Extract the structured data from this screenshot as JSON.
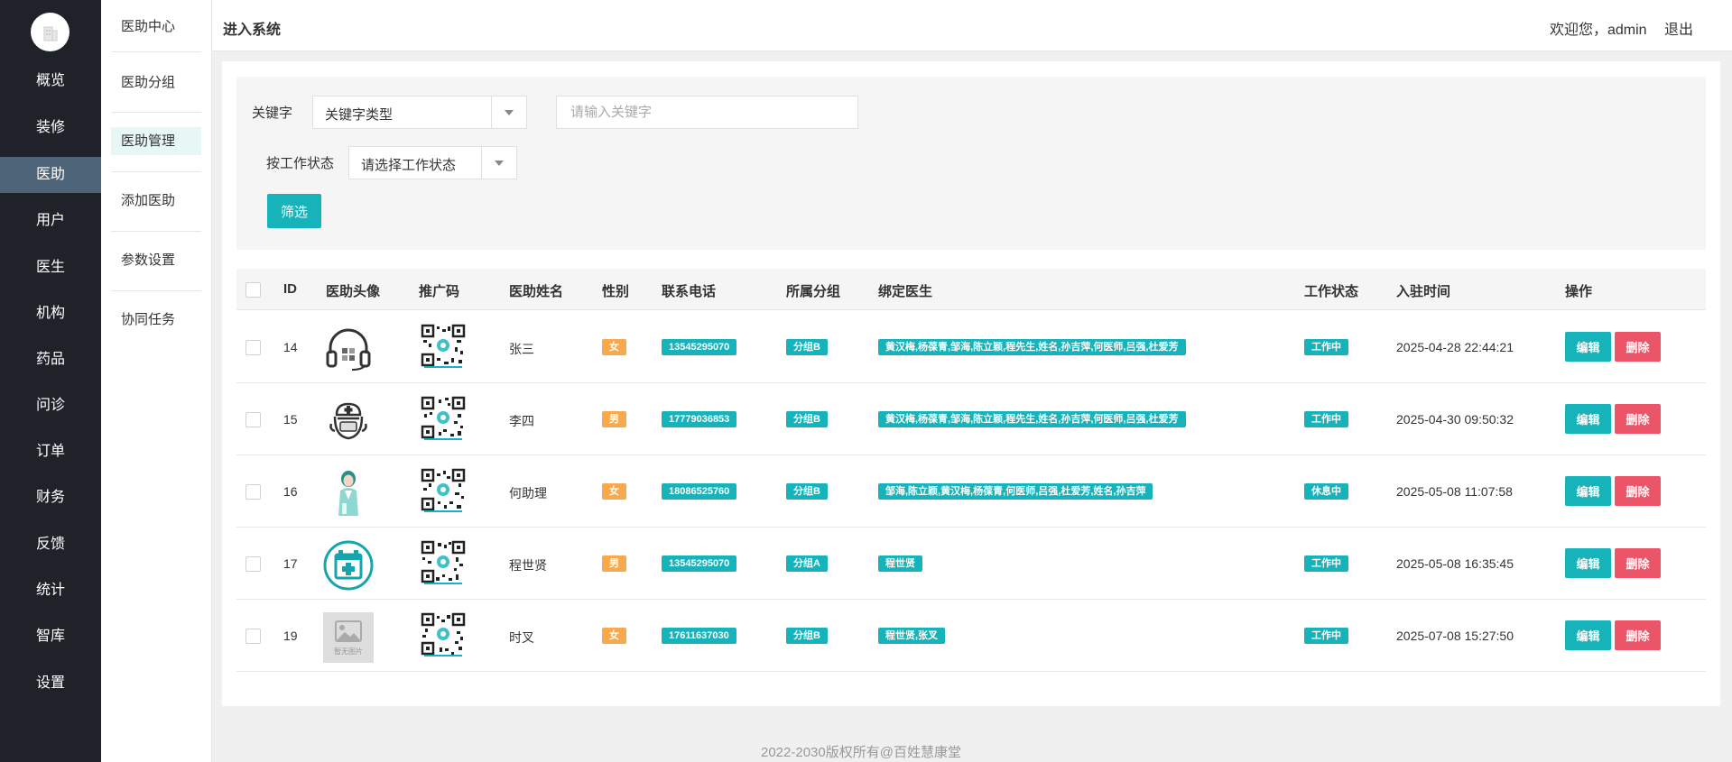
{
  "nav1": {
    "logo_icon": "building-icon",
    "items": [
      "概览",
      "装修",
      "医助",
      "用户",
      "医生",
      "机构",
      "药品",
      "问诊",
      "订单",
      "财务",
      "反馈",
      "统计",
      "智库",
      "设置"
    ],
    "active_index": 2
  },
  "nav2": {
    "items": [
      "医助中心",
      "医助分组",
      "医助管理",
      "添加医助",
      "参数设置",
      "协同任务"
    ],
    "active_index": 2
  },
  "header": {
    "title": "进入系统",
    "welcome": "欢迎您，admin",
    "logout": "退出"
  },
  "filter": {
    "keyword_label": "关键字",
    "keyword_type_value": "关键字类型",
    "keyword_placeholder": "请输入关键字",
    "status_label": "按工作状态",
    "status_value": "请选择工作状态",
    "submit_label": "筛选"
  },
  "table": {
    "headers": [
      "ID",
      "医助头像",
      "推广码",
      "医助姓名",
      "性别",
      "联系电话",
      "所属分组",
      "绑定医生",
      "工作状态",
      "入驻时间",
      "操作"
    ],
    "edit_label": "编辑",
    "delete_label": "删除",
    "rows": [
      {
        "id": "14",
        "avatar": "headset-avatar-icon",
        "name": "张三",
        "gender": "女",
        "phone": "13545295070",
        "group": "分组B",
        "doctors": "黄汉梅,杨葆青,邹海,陈立颖,程先生,姓名,孙吉萍,何医师,吕强,杜爱芳",
        "status": "工作中",
        "time": "2025-04-28 22:44:21"
      },
      {
        "id": "15",
        "avatar": "nurse-avatar-icon",
        "name": "李四",
        "gender": "男",
        "phone": "17779036853",
        "group": "分组B",
        "doctors": "黄汉梅,杨葆青,邹海,陈立颖,程先生,姓名,孙吉萍,何医师,吕强,杜爱芳",
        "status": "工作中",
        "time": "2025-04-30 09:50:32"
      },
      {
        "id": "16",
        "avatar": "female-doctor-avatar-icon",
        "name": "何助理",
        "gender": "女",
        "phone": "18086525760",
        "group": "分组B",
        "doctors": "邹海,陈立颖,黄汉梅,杨葆青,何医师,吕强,杜爱芳,姓名,孙吉萍",
        "status": "休息中",
        "time": "2025-05-08 11:07:58"
      },
      {
        "id": "17",
        "avatar": "hospital-avatar-icon",
        "name": "程世贤",
        "gender": "男",
        "phone": "13545295070",
        "group": "分组A",
        "doctors": "程世贤",
        "status": "工作中",
        "time": "2025-05-08 16:35:45"
      },
      {
        "id": "19",
        "avatar": "no-image-placeholder-icon",
        "avatar_text": "暂无图片",
        "name": "时叉",
        "gender": "女",
        "phone": "17611637030",
        "group": "分组B",
        "doctors": "程世贤,张叉",
        "status": "工作中",
        "time": "2025-07-08 15:27:50"
      }
    ]
  },
  "footer": "2022-2030版权所有@百姓慧康堂",
  "colors": {
    "accent": "#17b3bb",
    "danger": "#ec5468",
    "warning": "#f7a94b",
    "sidebar": "#20222a",
    "sidebar_active": "#4e6479"
  }
}
